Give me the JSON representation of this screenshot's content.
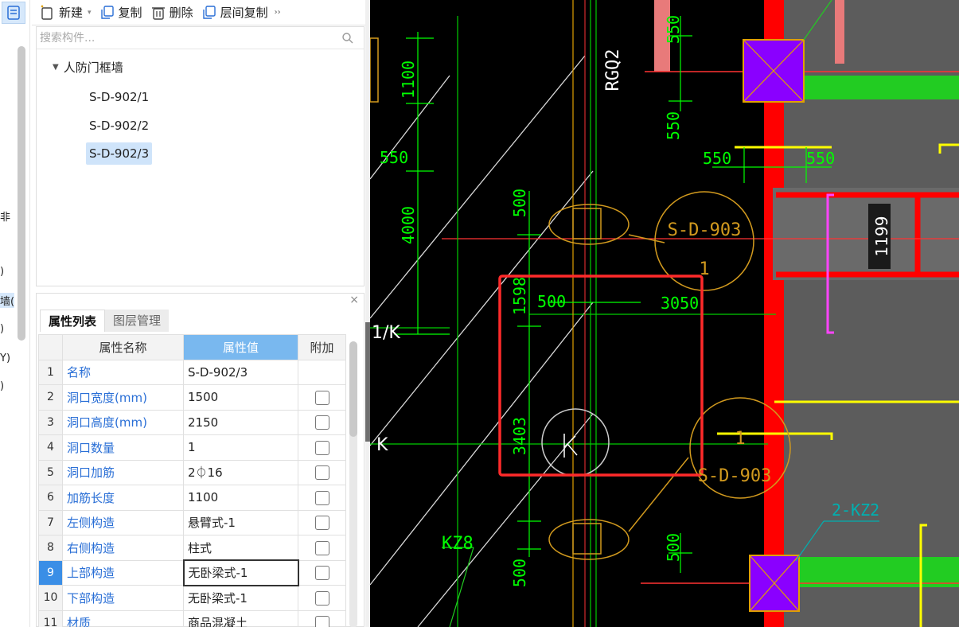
{
  "left_strip": {
    "fragments": [
      "非",
      ")",
      "墙(",
      ")",
      "Y)",
      ")"
    ]
  },
  "toolbar": {
    "new_label": "新建",
    "copy_label": "复制",
    "delete_label": "删除",
    "floor_copy_label": "层间复制",
    "more_label": "››"
  },
  "component_tree": {
    "search_placeholder": "搜索构件...",
    "root_label": "人防门框墙",
    "items": [
      "S-D-902/1",
      "S-D-902/2",
      "S-D-902/3"
    ],
    "selected_item": "S-D-902/3"
  },
  "property_panel": {
    "close_label": "×",
    "tabs": [
      "属性列表",
      "图层管理"
    ],
    "columns": [
      "属性名称",
      "属性值",
      "附加"
    ],
    "rows": [
      {
        "num": "1",
        "name": "名称",
        "value": "S-D-902/3"
      },
      {
        "num": "2",
        "name": "洞口宽度(mm)",
        "value": "1500"
      },
      {
        "num": "3",
        "name": "洞口高度(mm)",
        "value": "2150"
      },
      {
        "num": "4",
        "name": "洞口数量",
        "value": "1"
      },
      {
        "num": "5",
        "name": "洞口加筋",
        "value": "2⏀16"
      },
      {
        "num": "6",
        "name": "加筋长度",
        "value": "1100"
      },
      {
        "num": "7",
        "name": "左侧构造",
        "value": "悬臂式-1"
      },
      {
        "num": "8",
        "name": "右侧构造",
        "value": "柱式"
      },
      {
        "num": "9",
        "name": "上部构造",
        "value": "无卧梁式-1"
      },
      {
        "num": "10",
        "name": "下部构造",
        "value": "无卧梁式-1"
      },
      {
        "num": "11",
        "name": "材质",
        "value": "商品混凝土"
      }
    ],
    "active_row": "9"
  },
  "cad": {
    "labels": {
      "rgq": "RGQ2",
      "axis_1k": "1/K",
      "axis_k": "K",
      "kz8": "KZ8",
      "kz2": "2-KZ2",
      "door_top": "S-D-903",
      "door_top_num": "1",
      "door_bottom": "S-D-903",
      "door_bottom_num": "1",
      "tag_1199": "1199",
      "dims": {
        "d1100": "1100",
        "d550a": "550",
        "d4000": "4000",
        "d500a": "500",
        "d1598": "1598",
        "d500b": "500",
        "d3050": "3050",
        "d3403": "3403",
        "d500c": "500",
        "d500d": "500",
        "d550b": "550",
        "d550c": "550",
        "d550d": "550",
        "d550e": "550",
        "d550f": "550"
      }
    },
    "colors": {
      "background": "#000000",
      "dimension": "#00ff00",
      "wall_red": "#ff0000",
      "column_purple": "#8a00ff",
      "gray_fill": "#5a5a5a",
      "door_orange": "#d29a1e",
      "highlight_box": "#ff2a2a",
      "yellow": "#ffff00",
      "magenta": "#ff44ff",
      "cyan": "#00b0b0"
    }
  }
}
